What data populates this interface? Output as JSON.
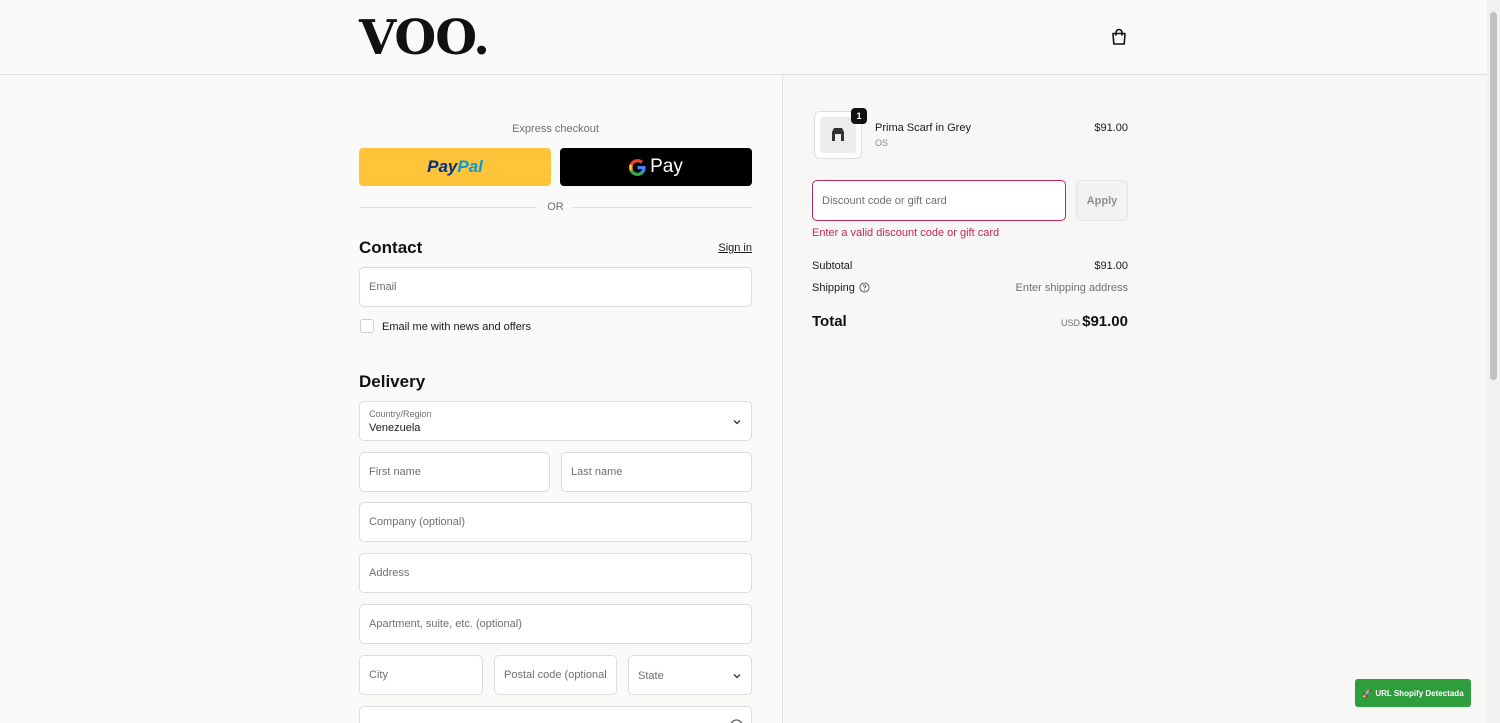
{
  "header": {
    "logo": "VOO.",
    "cart_icon": "shopping-bag-icon"
  },
  "express": {
    "label": "Express checkout",
    "paypal_a": "Pay",
    "paypal_b": "Pal",
    "gpay": "Pay",
    "or_text": "OR"
  },
  "contact": {
    "title": "Contact",
    "sign_in": "Sign in",
    "email_placeholder": "Email",
    "newsletter_label": "Email me with news and offers"
  },
  "delivery": {
    "title": "Delivery",
    "country_label": "Country/Region",
    "country_value": "Venezuela",
    "first_name": "First name",
    "last_name": "Last name",
    "company": "Company (optional)",
    "address": "Address",
    "apartment": "Apartment, suite, etc. (optional)",
    "city": "City",
    "postal": "Postal code (optional)",
    "state": "State"
  },
  "order": {
    "product": {
      "name": "Prima Scarf in Grey",
      "variant": "OS",
      "price": "$91.00",
      "quantity": "1"
    },
    "discount_placeholder": "Discount code or gift card",
    "apply_label": "Apply",
    "discount_error": "Enter a valid discount code or gift card",
    "subtotal_label": "Subtotal",
    "subtotal_value": "$91.00",
    "shipping_label": "Shipping",
    "shipping_value": "Enter shipping address",
    "total_label": "Total",
    "total_currency": "USD",
    "total_value": "$91.00"
  },
  "extension_badge": {
    "label": "URL Shopify Detectada"
  },
  "colors": {
    "accent_error": "#c3275f",
    "paypal_yellow": "#ffc439",
    "badge_green": "#2e9e3c"
  }
}
